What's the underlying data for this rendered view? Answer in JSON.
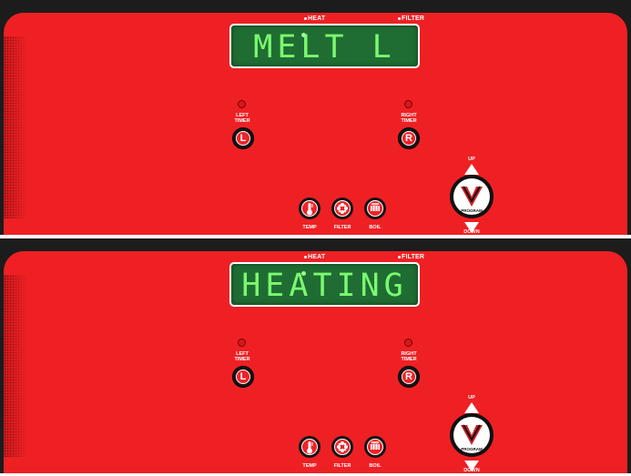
{
  "panels": [
    {
      "display_text": "MELT L",
      "heat_label": "HEAT",
      "filter_label": "FILTER",
      "left_timer_label_1": "LEFT",
      "left_timer_label_2": "TIMER",
      "right_timer_label_1": "RIGHT",
      "right_timer_label_2": "TIMER",
      "left_button": "L",
      "right_button": "R",
      "temp_label": "TEMP",
      "filter_button_label": "FILTER",
      "boil_label": "BOIL",
      "up_label": "UP",
      "down_label": "DOWN",
      "program_label": "PROGRAM",
      "logo_letter": "V"
    },
    {
      "display_text": "HEATING",
      "heat_label": "HEAT",
      "filter_label": "FILTER",
      "left_timer_label_1": "LEFT",
      "left_timer_label_2": "TIMER",
      "right_timer_label_1": "RIGHT",
      "right_timer_label_2": "TIMER",
      "left_button": "L",
      "right_button": "R",
      "temp_label": "TEMP",
      "filter_button_label": "FILTER",
      "boil_label": "BOIL",
      "up_label": "UP",
      "down_label": "DOWN",
      "program_label": "PROGRAM",
      "logo_letter": "V"
    }
  ],
  "colors": {
    "panel_red": "#ee2024",
    "lcd_green": "#1f6d33",
    "lcd_text": "#7cf96f",
    "frame_black": "#1c1c1c"
  },
  "icons": [
    "thermometer-icon",
    "filter-icon",
    "boil-icon",
    "program-v-logo"
  ]
}
